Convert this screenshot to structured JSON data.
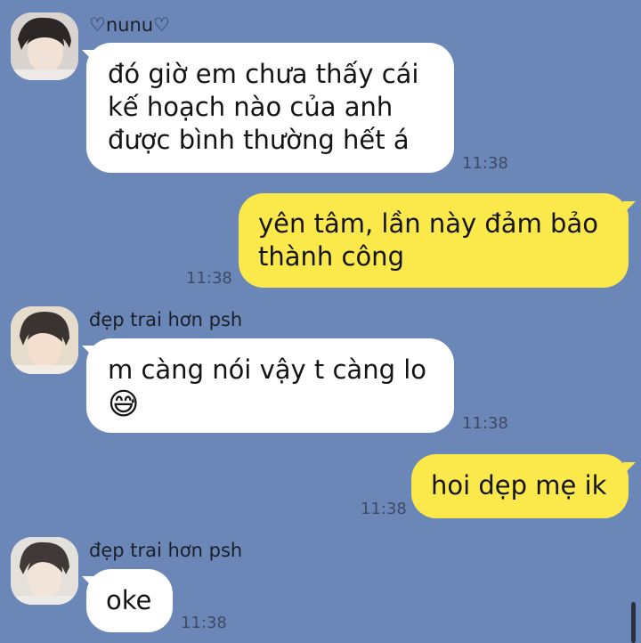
{
  "messages": [
    {
      "sender": "♡nunu♡",
      "lines": [
        "đó giờ em chưa thấy cái",
        "kế hoạch nào của anh",
        "được bình thường hết á"
      ],
      "time": "11:38"
    },
    {
      "lines": [
        "yên tâm, lần này đảm bảo",
        "thành công"
      ],
      "time": "11:38"
    },
    {
      "sender": "đẹp trai hơn psh",
      "lines": [
        "m càng nói vậy t càng lo"
      ],
      "emoji": "😅",
      "time": "11:38"
    },
    {
      "lines": [
        "hoi dẹp mẹ ik"
      ],
      "time": "11:38"
    },
    {
      "sender": "đẹp trai hơn psh",
      "lines": [
        "oke"
      ],
      "time": "11:38"
    }
  ],
  "icons": {
    "avatar": "profile-photo",
    "emoji": "sweat-smile-emoji"
  },
  "colors": {
    "background": "#6b87b7",
    "incoming_bubble": "#ffffff",
    "outgoing_bubble": "#fbe94b",
    "timestamp": "#3f4a63"
  }
}
